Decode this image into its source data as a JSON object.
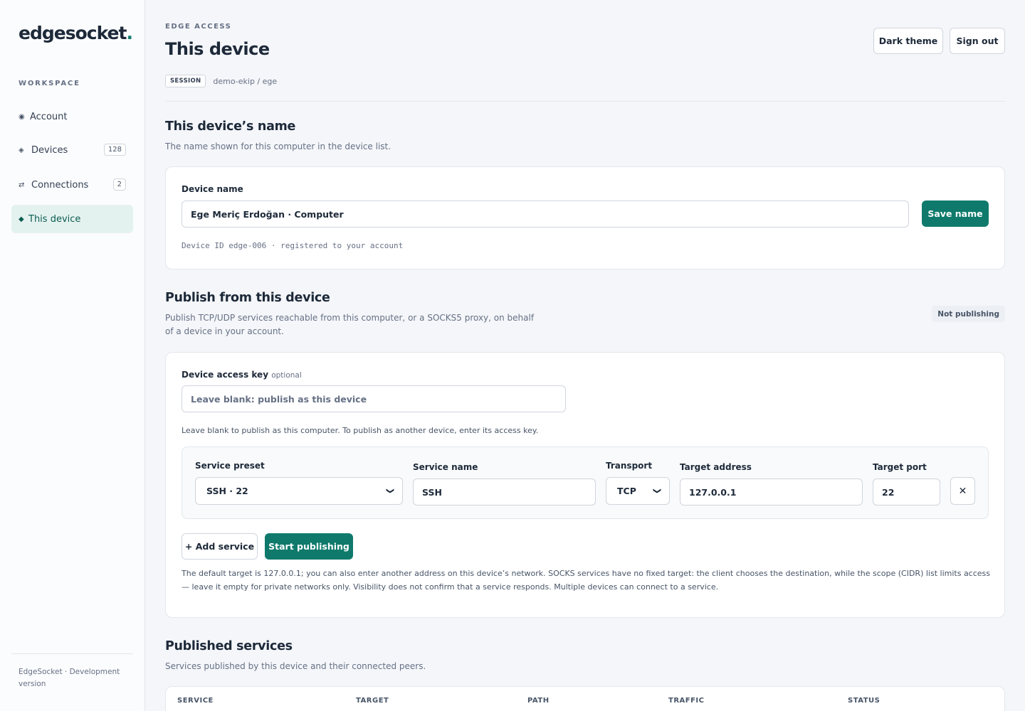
{
  "sidebar": {
    "logo_text": "edgesocket",
    "logo_dot": ".",
    "section_label": "WORKSPACE",
    "items": [
      {
        "icon": "◉",
        "icon_name": "account-icon",
        "label": "Account",
        "badge": ""
      },
      {
        "icon": "◈",
        "icon_name": "devices-icon",
        "label": "Devices",
        "badge": "128"
      },
      {
        "icon": "⇄",
        "icon_name": "connections-icon",
        "label": "Connections",
        "badge": "2"
      },
      {
        "icon": "◆",
        "icon_name": "this-device-icon",
        "label": "This device",
        "badge": ""
      }
    ],
    "active_index": 3,
    "footer": "EdgeSocket · Development version"
  },
  "header": {
    "eyebrow": "EDGE ACCESS",
    "title": "This device",
    "session_tag": "SESSION",
    "session_path": "demo-ekip / ege",
    "dark_theme_label": "Dark theme",
    "sign_out_label": "Sign out"
  },
  "device_name_section": {
    "title": "This device’s name",
    "description": "The name shown for this computer in the device list.",
    "field_label": "Device name",
    "field_value": "Ege Meriç Erdoğan · Computer",
    "save_label": "Save name",
    "device_id_note": "Device ID edge-006 · registered to your account"
  },
  "publish_section": {
    "title": "Publish from this device",
    "description": "Publish TCP/UDP services reachable from this computer, or a SOCKS5 proxy, on behalf of a device in your account.",
    "status": "Not publishing",
    "access_key_label": "Device access key",
    "access_key_optional": "optional",
    "access_key_placeholder": "Leave blank: publish as this device",
    "access_key_help": "Leave blank to publish as this computer. To publish as another device, enter its access key.",
    "service": {
      "preset_label": "Service preset",
      "preset_value": "SSH · 22",
      "name_label": "Service name",
      "name_value": "SSH",
      "transport_label": "Transport",
      "transport_value": "TCP",
      "target_address_label": "Target address",
      "target_address_value": "127.0.0.1",
      "target_port_label": "Target port",
      "target_port_value": "22",
      "remove_icon": "✕"
    },
    "add_service_label": "+ Add service",
    "start_label": "Start publishing",
    "footnote": "The default target is 127.0.0.1; you can also enter another address on this device’s network. SOCKS services have no fixed target: the client chooses the destination, while the scope (CIDR) list limits access — leave it empty for private networks only. Visibility does not confirm that a service responds. Multiple devices can connect to a service."
  },
  "published_section": {
    "title": "Published services",
    "description": "Services published by this device and their connected peers.",
    "columns": [
      "SERVICE",
      "TARGET",
      "PATH",
      "TRAFFIC",
      "STATUS"
    ]
  },
  "colors": {
    "accent": "#0f7a6c",
    "active_bg": "#e4f2ef",
    "page_bg": "#f4f6f9"
  }
}
